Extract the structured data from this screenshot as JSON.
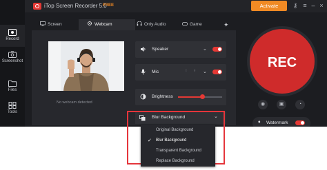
{
  "app": {
    "title": "iTop Screen Recorder 5.0",
    "badge": "FREE",
    "activate_label": "Activate"
  },
  "sidebar": {
    "items": [
      {
        "label": "Record",
        "icon": "record-icon"
      },
      {
        "label": "Screenshot",
        "icon": "camera-icon"
      },
      {
        "label": "Files",
        "icon": "folder-icon"
      },
      {
        "label": "Tools",
        "icon": "tools-icon"
      }
    ]
  },
  "tabs": [
    {
      "label": "Screen",
      "icon": "monitor-icon"
    },
    {
      "label": "Webcam",
      "icon": "webcam-icon"
    },
    {
      "label": "Only Audio",
      "icon": "audio-icon"
    },
    {
      "label": "Game",
      "icon": "gamepad-icon"
    }
  ],
  "webcam": {
    "status_text": "No webcam detected"
  },
  "settings": {
    "speaker_label": "Speaker",
    "mic_label": "Mic",
    "brightness_label": "Brightness",
    "brightness_level": 0.55,
    "blur_label": "Blur Background"
  },
  "blur_menu": {
    "options": [
      "Original Background",
      "Blur Background",
      "Transparent Background",
      "Replace Background"
    ],
    "selected": "Blur Background"
  },
  "right": {
    "rec_label": "REC",
    "watermark_label": "Watermark"
  },
  "colors": {
    "accent": "#e53935",
    "activate": "#f08a24",
    "highlight_box": "#e5353b"
  }
}
